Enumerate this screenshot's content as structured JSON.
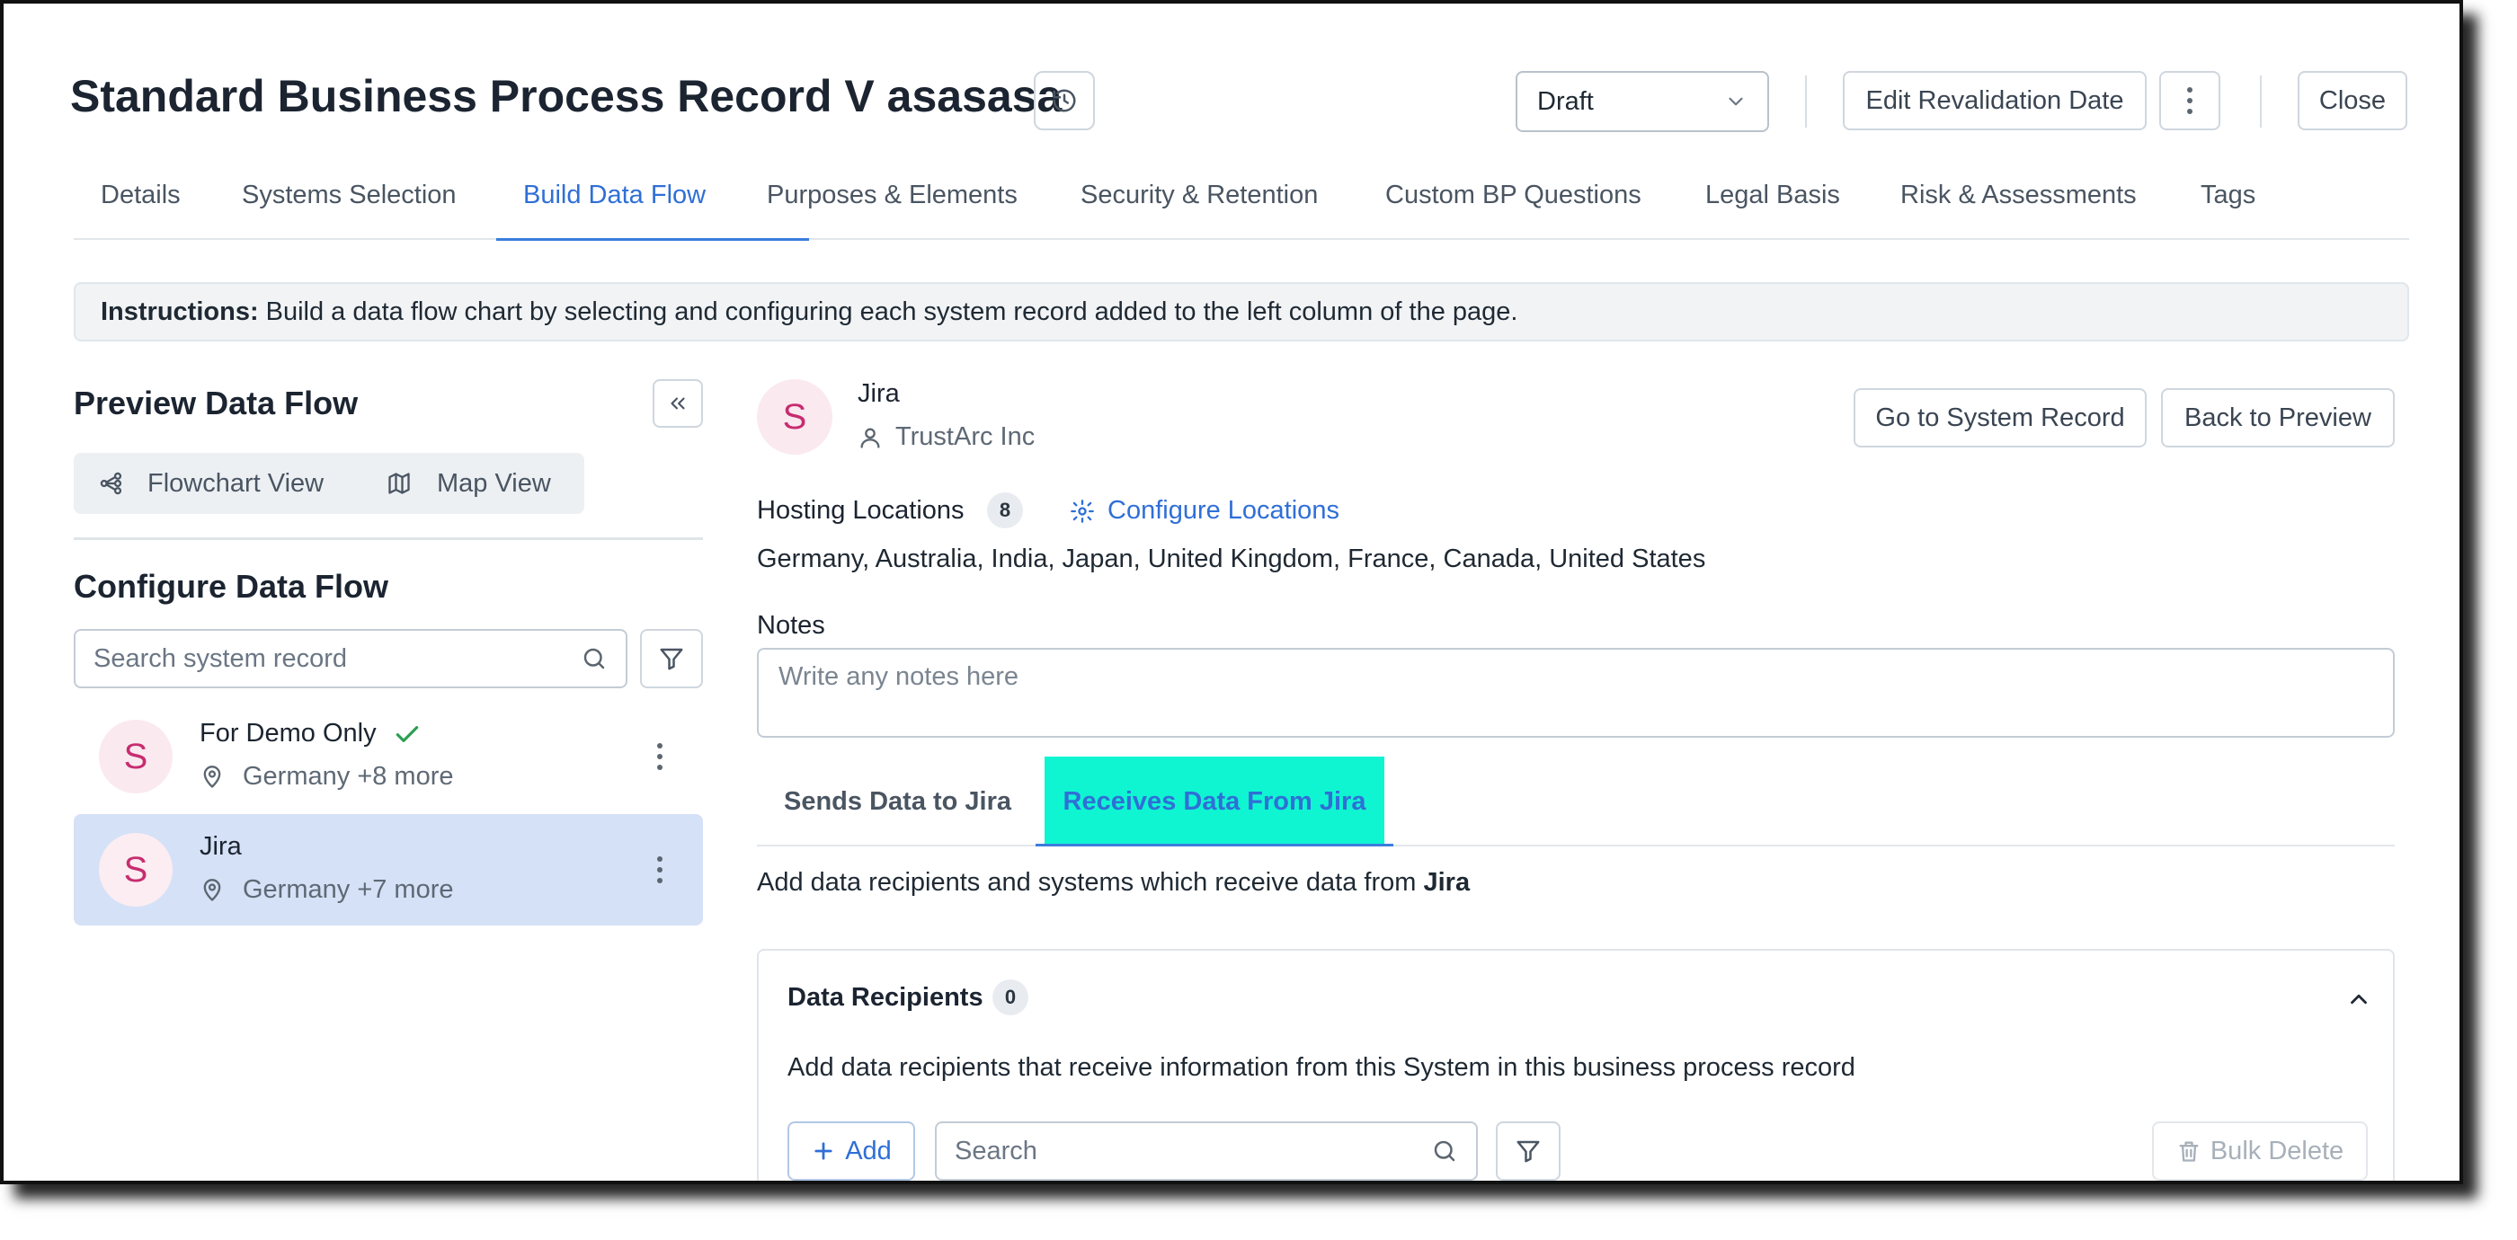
{
  "header": {
    "title": "Standard Business Process Record V asasasa",
    "status_value": "Draft",
    "edit_revalidation_label": "Edit Revalidation Date",
    "close_label": "Close"
  },
  "tabs": [
    {
      "label": "Details",
      "active": false
    },
    {
      "label": "Systems Selection",
      "active": false
    },
    {
      "label": "Build Data Flow",
      "active": true
    },
    {
      "label": "Purposes & Elements",
      "active": false
    },
    {
      "label": "Security & Retention",
      "active": false
    },
    {
      "label": "Custom BP Questions",
      "active": false
    },
    {
      "label": "Legal Basis",
      "active": false
    },
    {
      "label": "Risk & Assessments",
      "active": false
    },
    {
      "label": "Tags",
      "active": false
    }
  ],
  "instructions": {
    "label": "Instructions:",
    "text": "Build a data flow chart by selecting and configuring each system record added to the left column of the page."
  },
  "left": {
    "preview_title": "Preview Data Flow",
    "flowchart_view": "Flowchart View",
    "map_view": "Map View",
    "configure_title": "Configure Data Flow",
    "search_placeholder": "Search system record",
    "records": [
      {
        "initial": "S",
        "name": "For Demo Only",
        "location": "Germany +8 more",
        "verified": true,
        "selected": false
      },
      {
        "initial": "S",
        "name": "Jira",
        "location": "Germany +7 more",
        "verified": false,
        "selected": true
      }
    ]
  },
  "right": {
    "system_initial": "S",
    "system_name": "Jira",
    "owner": "TrustArc Inc",
    "go_to_system_label": "Go to System Record",
    "back_to_preview_label": "Back to Preview",
    "hosting_label": "Hosting Locations",
    "hosting_count": "8",
    "configure_locations_label": "Configure Locations",
    "locations": "Germany, Australia, India, Japan, United Kingdom, France, Canada, United States",
    "notes_label": "Notes",
    "notes_placeholder": "Write any notes here",
    "subtabs": [
      {
        "label": "Sends Data to Jira",
        "active": false
      },
      {
        "label": "Receives Data From Jira",
        "active": true
      }
    ],
    "receive_desc_prefix": "Add data recipients and systems which receive data from",
    "receive_desc_system": "Jira",
    "recipients": {
      "title": "Data Recipients",
      "count": "0",
      "description": "Add data recipients that receive information from this System in this business process record",
      "add_label": "Add",
      "search_placeholder": "Search",
      "bulk_delete_label": "Bulk Delete"
    }
  }
}
